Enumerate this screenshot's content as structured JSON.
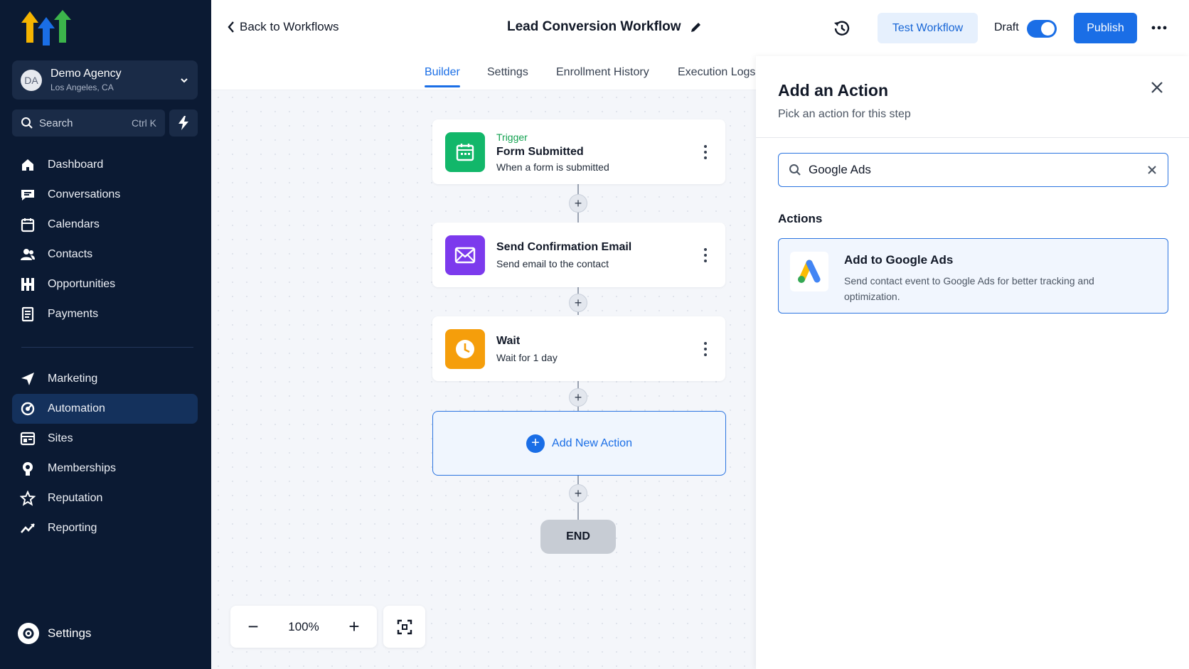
{
  "sidebar": {
    "agency": {
      "initials": "DA",
      "name": "Demo Agency",
      "location": "Los Angeles, CA"
    },
    "search": {
      "label": "Search",
      "shortcut": "Ctrl K"
    },
    "nav_primary": [
      {
        "label": "Dashboard",
        "icon": "home-icon"
      },
      {
        "label": "Conversations",
        "icon": "chat-icon"
      },
      {
        "label": "Calendars",
        "icon": "calendar-icon"
      },
      {
        "label": "Contacts",
        "icon": "contacts-icon"
      },
      {
        "label": "Opportunities",
        "icon": "opportunities-icon"
      },
      {
        "label": "Payments",
        "icon": "payments-icon"
      }
    ],
    "nav_secondary": [
      {
        "label": "Marketing",
        "icon": "send-icon"
      },
      {
        "label": "Automation",
        "icon": "automation-icon",
        "active": true
      },
      {
        "label": "Sites",
        "icon": "sites-icon"
      },
      {
        "label": "Memberships",
        "icon": "memberships-icon"
      },
      {
        "label": "Reputation",
        "icon": "star-icon"
      },
      {
        "label": "Reporting",
        "icon": "trend-icon"
      }
    ],
    "settings_label": "Settings"
  },
  "header": {
    "back_label": "Back to Workflows",
    "workflow_title": "Lead Conversion Workflow",
    "test_label": "Test Workflow",
    "draft_label": "Draft",
    "draft_on": true,
    "publish_label": "Publish"
  },
  "tabs": [
    {
      "label": "Builder",
      "active": true
    },
    {
      "label": "Settings"
    },
    {
      "label": "Enrollment History"
    },
    {
      "label": "Execution Logs"
    }
  ],
  "workflow": {
    "nodes": [
      {
        "tag": "Trigger",
        "title": "Form Submitted",
        "subtitle": "When a form is submitted",
        "icon": "calendar-icon",
        "color": "#12b76a"
      },
      {
        "title": "Send Confirmation Email",
        "subtitle": "Send email to the contact",
        "icon": "mail-icon",
        "color": "#7c3aed"
      },
      {
        "title": "Wait",
        "subtitle": "Wait for 1 day",
        "icon": "clock-icon",
        "color": "#f59e0b"
      }
    ],
    "add_action_label": "Add New Action",
    "end_label": "END"
  },
  "zoom": {
    "value": "100%"
  },
  "panel": {
    "title": "Add an Action",
    "subtitle": "Pick an action for this step",
    "search_value": "Google Ads",
    "section_label": "Actions",
    "result": {
      "title": "Add to Google Ads",
      "description": "Send contact event to Google Ads for better tracking and optimization."
    }
  },
  "colors": {
    "sidebar_bg": "#0b1a33",
    "accent": "#1a6ee6",
    "active_nav": "#14315c"
  }
}
